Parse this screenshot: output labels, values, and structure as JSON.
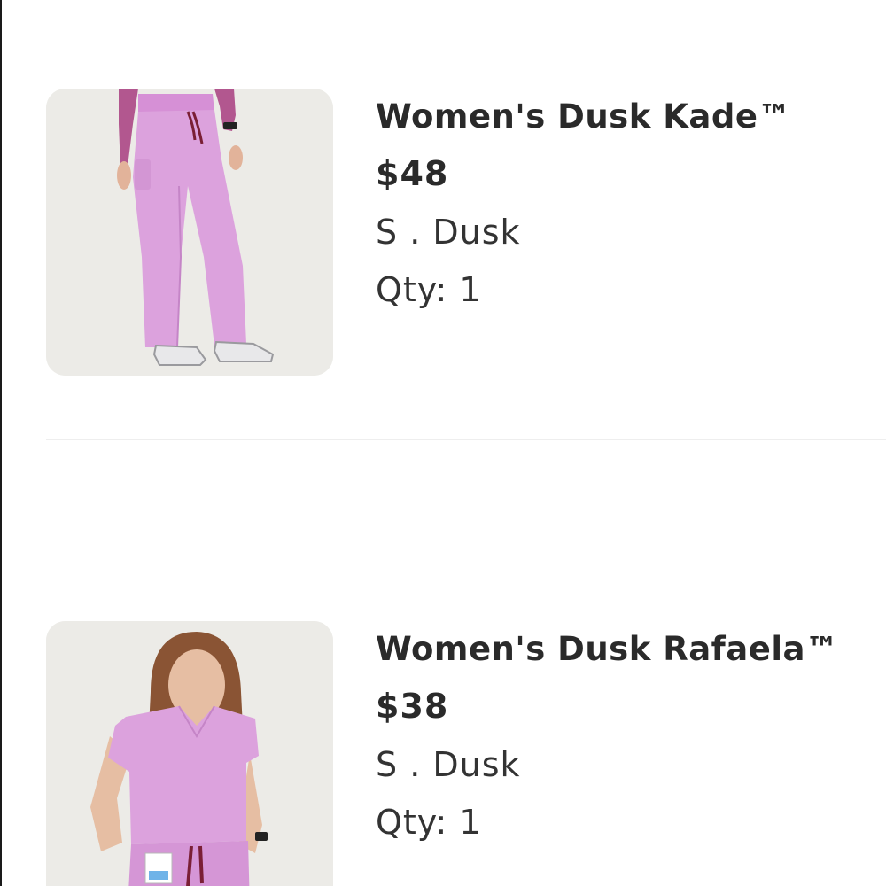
{
  "cart": {
    "items": [
      {
        "image_alt": "Women's Dusk Kade pants",
        "name": "Women's Dusk Kade™",
        "price": "$48",
        "variant": "S . Dusk",
        "qty": "Qty: 1"
      },
      {
        "image_alt": "Women's Dusk Rafaela top",
        "name": "Women's Dusk Rafaela™",
        "price": "$38",
        "variant": "S . Dusk",
        "qty": "Qty: 1"
      }
    ]
  },
  "colors": {
    "dusk": "#dca2dd",
    "drawstring": "#7a1f35",
    "photo_background": "#ecebe7"
  }
}
